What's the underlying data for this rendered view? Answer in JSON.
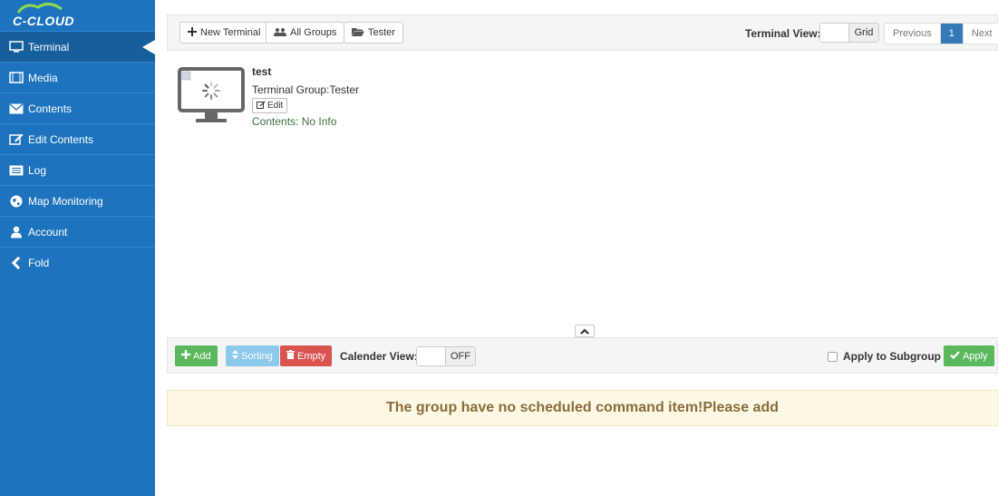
{
  "brand": {
    "name": "C-CLOUD"
  },
  "sidebar": {
    "items": [
      {
        "label": "Terminal",
        "icon": "monitor-icon"
      },
      {
        "label": "Media",
        "icon": "film-icon"
      },
      {
        "label": "Contents",
        "icon": "envelope-icon"
      },
      {
        "label": "Edit Contents",
        "icon": "edit-icon"
      },
      {
        "label": "Log",
        "icon": "list-icon"
      },
      {
        "label": "Map Monitoring",
        "icon": "globe-icon"
      },
      {
        "label": "Account",
        "icon": "user-icon"
      },
      {
        "label": "Fold",
        "icon": "chevron-left-icon"
      }
    ]
  },
  "toolbar": {
    "new_terminal": "New Terminal",
    "all_groups": "All Groups",
    "tester": "Tester",
    "terminal_view_label": "Terminal View:",
    "view_switch": "Grid",
    "pager": {
      "previous": "Previous",
      "current": "1",
      "next": "Next"
    }
  },
  "terminal": {
    "name": "test",
    "group": "Terminal Group:Tester",
    "edit": "Edit",
    "contents": "Contents: No Info"
  },
  "commands": {
    "add": "Add",
    "sorting": "Sorting",
    "empty": "Empty",
    "calendar_label": "Calender View:",
    "calendar_switch": "OFF",
    "apply_subgroup": "Apply to Subgroup",
    "apply": "Apply"
  },
  "notice": "The group have no scheduled command item!Please add",
  "colors": {
    "sidebar": "#1e73be",
    "sidebar_active": "#175e9c",
    "add": "#5cb85c",
    "sorting": "#8dc9ea",
    "empty": "#d9534f",
    "apply": "#5cb85c",
    "pager_active": "#337ab7",
    "notice_bg": "#fcf8e3",
    "notice_text": "#8a6d3b"
  }
}
